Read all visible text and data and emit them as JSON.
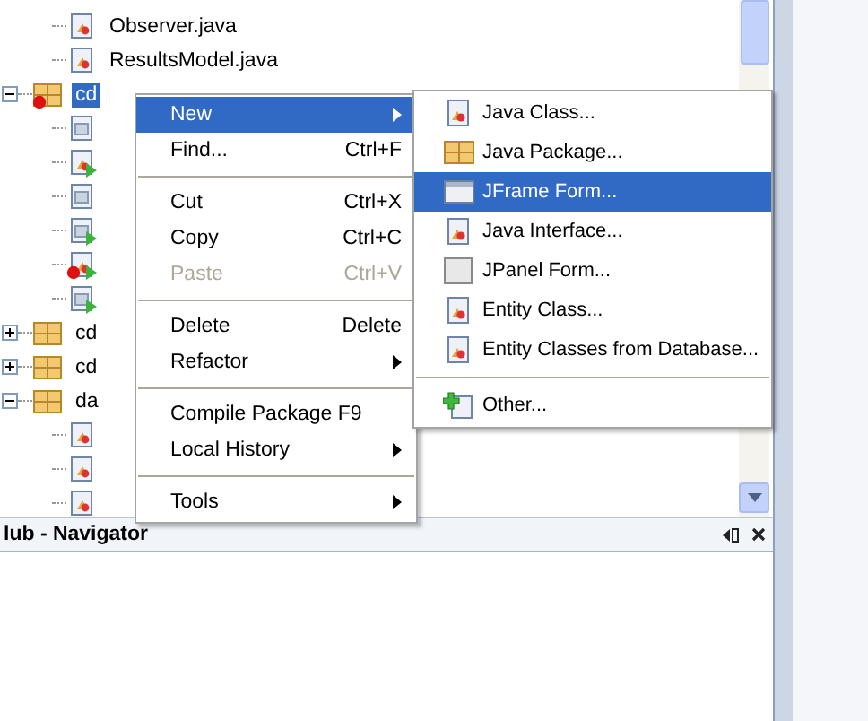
{
  "tree": {
    "top_children": [
      {
        "label": "Observer.java",
        "kind": "java",
        "error": false,
        "runnable": false,
        "selected": false
      },
      {
        "label": "ResultsModel.java",
        "kind": "java",
        "error": false,
        "runnable": false,
        "selected": false
      }
    ],
    "items": [
      {
        "label": "cd",
        "kind": "package",
        "error": true,
        "runnable": false,
        "expanded": true,
        "selected": true,
        "children": [
          {
            "kind": "form",
            "error": false,
            "runnable": false
          },
          {
            "kind": "java",
            "error": false,
            "runnable": true
          },
          {
            "kind": "form",
            "error": false,
            "runnable": false
          },
          {
            "kind": "form",
            "error": false,
            "runnable": true
          },
          {
            "kind": "java",
            "error": true,
            "runnable": true
          },
          {
            "kind": "form",
            "error": false,
            "runnable": true
          }
        ]
      },
      {
        "label": "cd",
        "kind": "package",
        "error": false,
        "runnable": false,
        "expanded": false,
        "selected": false
      },
      {
        "label": "cd",
        "kind": "package",
        "error": false,
        "runnable": false,
        "expanded": false,
        "selected": false
      },
      {
        "label": "da",
        "kind": "package",
        "error": false,
        "runnable": false,
        "expanded": true,
        "selected": false,
        "children": [
          {
            "kind": "java",
            "error": false,
            "runnable": false
          },
          {
            "kind": "java",
            "error": false,
            "runnable": false
          },
          {
            "kind": "java",
            "error": false,
            "runnable": false
          }
        ]
      }
    ]
  },
  "context_menu": {
    "items": [
      {
        "kind": "item",
        "label": "New",
        "submenu": true,
        "selected": true,
        "disabled": false
      },
      {
        "kind": "item",
        "label": "Find...",
        "shortcut": "Ctrl+F",
        "submenu": false,
        "selected": false,
        "disabled": false
      },
      {
        "kind": "separator"
      },
      {
        "kind": "item",
        "label": "Cut",
        "shortcut": "Ctrl+X",
        "submenu": false,
        "selected": false,
        "disabled": false
      },
      {
        "kind": "item",
        "label": "Copy",
        "shortcut": "Ctrl+C",
        "submenu": false,
        "selected": false,
        "disabled": false
      },
      {
        "kind": "item",
        "label": "Paste",
        "shortcut": "Ctrl+V",
        "submenu": false,
        "selected": false,
        "disabled": true
      },
      {
        "kind": "separator"
      },
      {
        "kind": "item",
        "label": "Delete",
        "shortcut": "Delete",
        "submenu": false,
        "selected": false,
        "disabled": false
      },
      {
        "kind": "item",
        "label": "Refactor",
        "submenu": true,
        "selected": false,
        "disabled": false
      },
      {
        "kind": "separator"
      },
      {
        "kind": "item",
        "label": "Compile Package F9",
        "submenu": false,
        "selected": false,
        "disabled": false
      },
      {
        "kind": "item",
        "label": "Local History",
        "submenu": true,
        "selected": false,
        "disabled": false
      },
      {
        "kind": "separator"
      },
      {
        "kind": "item",
        "label": "Tools",
        "submenu": true,
        "selected": false,
        "disabled": false
      }
    ]
  },
  "submenu": {
    "items": [
      {
        "kind": "class",
        "label": "Java Class...",
        "selected": false
      },
      {
        "kind": "package",
        "label": "Java Package...",
        "selected": false
      },
      {
        "kind": "form",
        "label": "JFrame Form...",
        "selected": true
      },
      {
        "kind": "class",
        "label": "Java Interface...",
        "selected": false
      },
      {
        "kind": "panel",
        "label": "JPanel Form...",
        "selected": false
      },
      {
        "kind": "class",
        "label": "Entity Class...",
        "selected": false
      },
      {
        "kind": "class",
        "label": "Entity Classes from Database...",
        "selected": false
      },
      {
        "kind": "separator"
      },
      {
        "kind": "other",
        "label": "Other...",
        "selected": false
      }
    ]
  },
  "navigator": {
    "title": "lub - Navigator"
  }
}
